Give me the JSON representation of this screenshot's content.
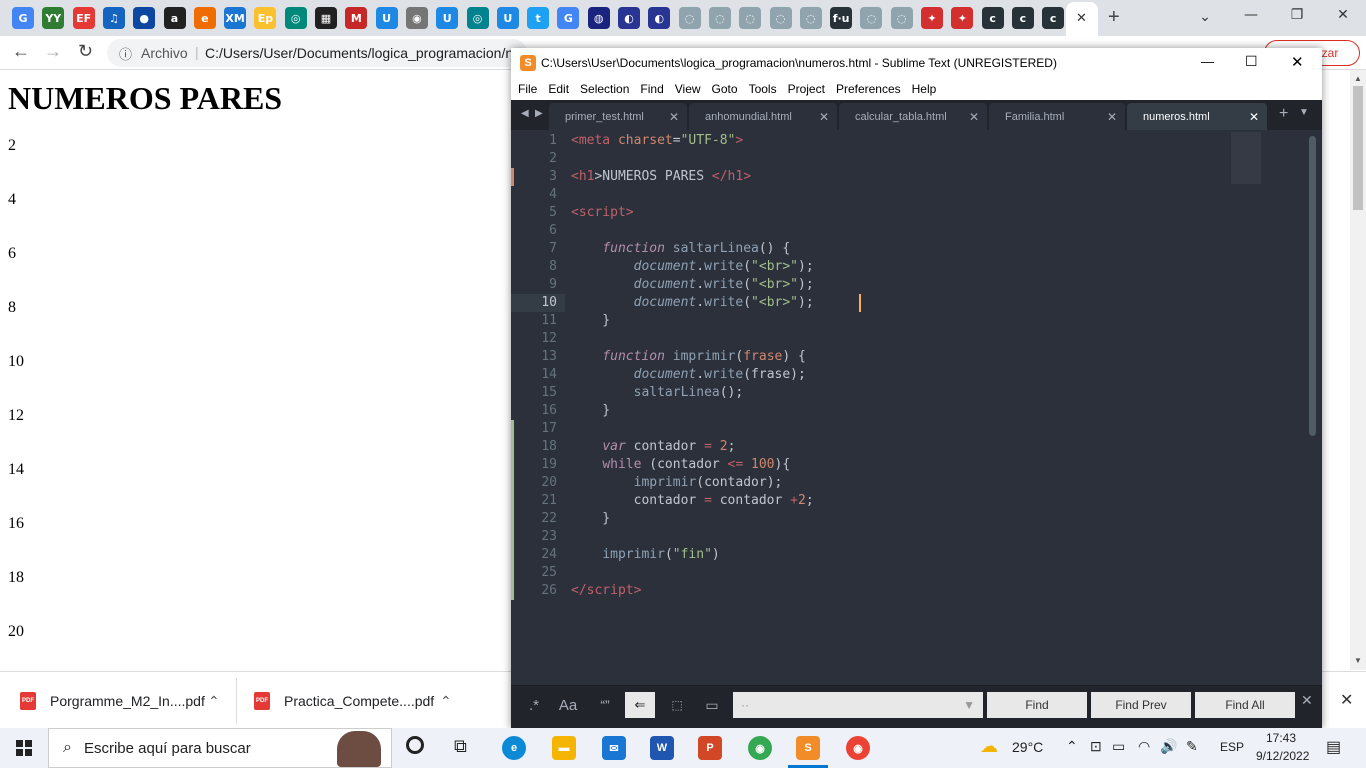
{
  "browser": {
    "address": "C:/Users/User/Documents/logica_programacion/n",
    "address_prefix": "Archivo",
    "update_button": "Actualizar",
    "tab_favicons": [
      {
        "label": "G",
        "color": "#4285f4"
      },
      {
        "label": "YY",
        "color": "#2e7d32"
      },
      {
        "label": "EF",
        "color": "#e53935"
      },
      {
        "label": "♫",
        "color": "#1565c0"
      },
      {
        "label": "●",
        "color": "#0d47a1"
      },
      {
        "label": "a",
        "color": "#212121"
      },
      {
        "label": "e",
        "color": "#ef6c00"
      },
      {
        "label": "XM",
        "color": "#1976d2"
      },
      {
        "label": "Ep",
        "color": "#fbc02d"
      },
      {
        "label": "◎",
        "color": "#00897b"
      },
      {
        "label": "▦",
        "color": "#212121"
      },
      {
        "label": "M",
        "color": "#c62828"
      },
      {
        "label": "U",
        "color": "#1e88e5"
      },
      {
        "label": "◉",
        "color": "#757575"
      },
      {
        "label": "U",
        "color": "#1e88e5"
      },
      {
        "label": "◎",
        "color": "#00838f"
      },
      {
        "label": "U",
        "color": "#1e88e5"
      },
      {
        "label": "t",
        "color": "#1da1f2"
      },
      {
        "label": "G",
        "color": "#4285f4"
      },
      {
        "label": "◍",
        "color": "#1a237e"
      },
      {
        "label": "◐",
        "color": "#283593"
      },
      {
        "label": "◐",
        "color": "#283593"
      },
      {
        "label": "◌",
        "color": "#90a4ae"
      },
      {
        "label": "◌",
        "color": "#90a4ae"
      },
      {
        "label": "◌",
        "color": "#90a4ae"
      },
      {
        "label": "◌",
        "color": "#90a4ae"
      },
      {
        "label": "◌",
        "color": "#90a4ae"
      },
      {
        "label": "f·u",
        "color": "#263238"
      },
      {
        "label": "◌",
        "color": "#90a4ae"
      },
      {
        "label": "◌",
        "color": "#90a4ae"
      },
      {
        "label": "✦",
        "color": "#d32f2f"
      },
      {
        "label": "✦",
        "color": "#d32f2f"
      },
      {
        "label": "c",
        "color": "#263238"
      },
      {
        "label": "c",
        "color": "#263238"
      },
      {
        "label": "c",
        "color": "#263238"
      }
    ]
  },
  "page": {
    "heading": "NUMEROS PARES",
    "numbers": [
      "2",
      "4",
      "6",
      "8",
      "10",
      "12",
      "14",
      "16",
      "18",
      "20"
    ]
  },
  "downloads": [
    {
      "name": "Porgramme_M2_In....pdf"
    },
    {
      "name": "Practica_Compete....pdf"
    }
  ],
  "sublime": {
    "title": "C:\\Users\\User\\Documents\\logica_programacion\\numeros.html - Sublime Text (UNREGISTERED)",
    "menu": [
      "File",
      "Edit",
      "Selection",
      "Find",
      "View",
      "Goto",
      "Tools",
      "Project",
      "Preferences",
      "Help"
    ],
    "tabs": [
      {
        "label": "primer_test.html",
        "active": false
      },
      {
        "label": "anhomundial.html",
        "active": false
      },
      {
        "label": "calcular_tabla.html",
        "active": false
      },
      {
        "label": "Familia.html",
        "active": false
      },
      {
        "label": "numeros.html",
        "active": true
      }
    ],
    "current_line": 10,
    "lines": [
      [
        [
          "t",
          "<meta "
        ],
        [
          "a",
          "charset"
        ],
        [
          "o",
          "="
        ],
        [
          "s",
          "\"UTF-8\""
        ],
        [
          "t",
          ">"
        ]
      ],
      [],
      [
        [
          "t",
          "<h1"
        ],
        [
          "o",
          ">NUMEROS PARES "
        ],
        [
          "t",
          "</h1"
        ],
        [
          "t",
          ">"
        ]
      ],
      [],
      [
        [
          "t",
          "<script"
        ],
        [
          "t",
          ">"
        ]
      ],
      [],
      [
        [
          "o",
          "    "
        ],
        [
          "k",
          "function"
        ],
        [
          "o",
          " "
        ],
        [
          "f",
          "saltarLinea"
        ],
        [
          "o",
          "() {"
        ]
      ],
      [
        [
          "o",
          "        "
        ],
        [
          "i",
          "document"
        ],
        [
          "o",
          "."
        ],
        [
          "f",
          "write"
        ],
        [
          "o",
          "("
        ],
        [
          "s",
          "\"<br>\""
        ],
        [
          "o",
          ");"
        ]
      ],
      [
        [
          "o",
          "        "
        ],
        [
          "i",
          "document"
        ],
        [
          "o",
          "."
        ],
        [
          "f",
          "write"
        ],
        [
          "o",
          "("
        ],
        [
          "s",
          "\"<br>\""
        ],
        [
          "o",
          ");"
        ]
      ],
      [
        [
          "o",
          "        "
        ],
        [
          "i",
          "document"
        ],
        [
          "o",
          "."
        ],
        [
          "f",
          "write"
        ],
        [
          "o",
          "("
        ],
        [
          "s",
          "\"<br>\""
        ],
        [
          "o",
          ");"
        ]
      ],
      [
        [
          "o",
          "    }"
        ]
      ],
      [],
      [
        [
          "o",
          "    "
        ],
        [
          "k",
          "function"
        ],
        [
          "o",
          " "
        ],
        [
          "f",
          "imprimir"
        ],
        [
          "o",
          "("
        ],
        [
          "a",
          "frase"
        ],
        [
          "o",
          ") {"
        ]
      ],
      [
        [
          "o",
          "        "
        ],
        [
          "i",
          "document"
        ],
        [
          "o",
          "."
        ],
        [
          "f",
          "write"
        ],
        [
          "o",
          "(frase);"
        ]
      ],
      [
        [
          "o",
          "        "
        ],
        [
          "f",
          "saltarLinea"
        ],
        [
          "o",
          "();"
        ]
      ],
      [
        [
          "o",
          "    }"
        ]
      ],
      [],
      [
        [
          "o",
          "    "
        ],
        [
          "k",
          "var"
        ],
        [
          "o",
          " contador "
        ],
        [
          "t",
          "="
        ],
        [
          "o",
          " "
        ],
        [
          "n",
          "2"
        ],
        [
          "o",
          ";"
        ]
      ],
      [
        [
          "o",
          "    "
        ],
        [
          "kw",
          "while"
        ],
        [
          "o",
          " (contador "
        ],
        [
          "t",
          "<="
        ],
        [
          "o",
          " "
        ],
        [
          "n",
          "100"
        ],
        [
          "o",
          "){"
        ]
      ],
      [
        [
          "o",
          "        "
        ],
        [
          "f",
          "imprimir"
        ],
        [
          "o",
          "(contador);"
        ]
      ],
      [
        [
          "o",
          "        contador "
        ],
        [
          "t",
          "="
        ],
        [
          "o",
          " contador "
        ],
        [
          "t",
          "+"
        ],
        [
          "n",
          "2"
        ],
        [
          "o",
          ";"
        ]
      ],
      [
        [
          "o",
          "    }"
        ]
      ],
      [],
      [
        [
          "o",
          "    "
        ],
        [
          "f",
          "imprimir"
        ],
        [
          "o",
          "("
        ],
        [
          "s",
          "\"fin\""
        ],
        [
          "o",
          ")"
        ]
      ],
      [],
      [
        [
          "t",
          "</script"
        ],
        [
          "t",
          ">"
        ]
      ]
    ],
    "find": {
      "regex": ".*",
      "case": "Aa",
      "word": "“”",
      "find": "Find",
      "find_prev": "Find Prev",
      "find_all": "Find All"
    }
  },
  "taskbar": {
    "search_placeholder": "Escribe aquí para buscar",
    "weather": "29°C",
    "lang": "ESP",
    "time": "17:43",
    "date": "9/12/2022"
  }
}
